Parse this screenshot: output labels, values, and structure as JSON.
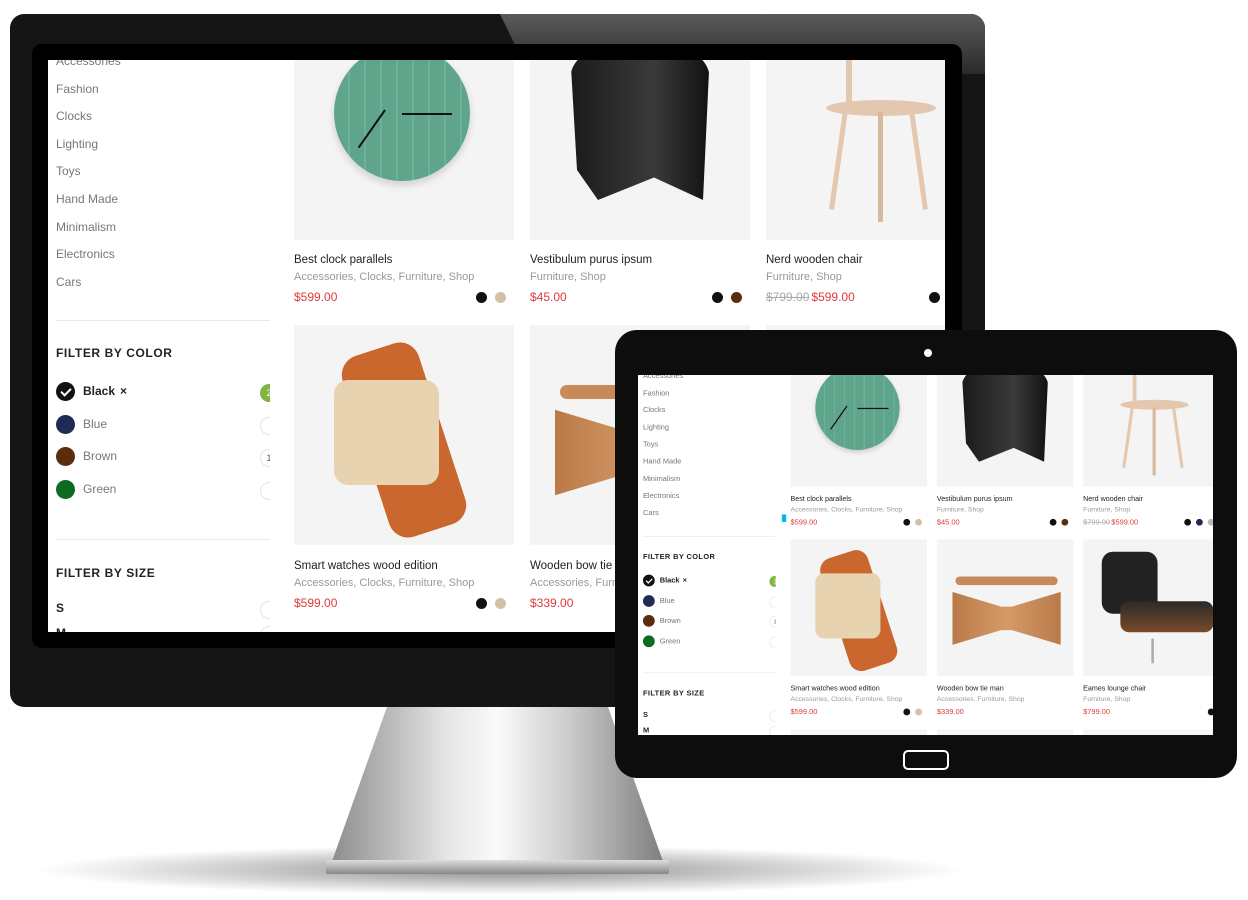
{
  "sidebar": {
    "categories": [
      "Accessories",
      "Fashion",
      "Clocks",
      "Lighting",
      "Toys",
      "Hand Made",
      "Minimalism",
      "Electronics",
      "Cars"
    ],
    "filter_color_title": "FILTER BY COLOR",
    "colors": [
      {
        "label": "Black",
        "remove": "×",
        "count": "2",
        "swatch": "#111111",
        "active": true
      },
      {
        "label": "Blue",
        "count": "",
        "swatch": "#1f2a55",
        "active": false
      },
      {
        "label": "Brown",
        "count": "1",
        "swatch": "#5a2d0c",
        "active": false
      },
      {
        "label": "Green",
        "count": "",
        "swatch": "#0c6b22",
        "active": false
      }
    ],
    "filter_size_title": "FILTER BY SIZE",
    "sizes": [
      {
        "label": "S"
      },
      {
        "label": "M"
      }
    ]
  },
  "products": [
    {
      "title": "Best clock parallels",
      "categories": "Accessories, Clocks, Furniture, Shop",
      "price": "$599.00",
      "old_price": "",
      "swatches": [
        "#111111",
        "#d3bfa3"
      ],
      "image": "clock"
    },
    {
      "title": "Vestibulum purus ipsum",
      "categories": "Furniture, Shop",
      "price": "$45.00",
      "old_price": "",
      "swatches": [
        "#111111",
        "#5a2d0c"
      ],
      "image": "stool"
    },
    {
      "title": "Nerd wooden chair",
      "categories": "Furniture, Shop",
      "price": "$599.00",
      "old_price": "$799.00",
      "swatches": [
        "#111111",
        "#1f2a55",
        "#bbbbbb"
      ],
      "image": "chair"
    },
    {
      "title": "Smart watches wood edition",
      "categories": "Accessories, Clocks, Furniture, Shop",
      "price": "$599.00",
      "old_price": "",
      "swatches": [
        "#111111",
        "#d3bfa3"
      ],
      "image": "watch"
    },
    {
      "title": "Wooden bow tie man",
      "categories": "Accessories, Furniture, Shop",
      "price": "$339.00",
      "old_price": "",
      "swatches": [],
      "image": "bowtie"
    },
    {
      "title": "Eames lounge chair",
      "categories": "Furniture, Shop",
      "price": "$799.00",
      "old_price": "",
      "swatches": [
        "#111111"
      ],
      "image": "lounge"
    }
  ],
  "colors": {
    "price": "#e03a3a",
    "badge_active": "#81b441",
    "bezel": "#151515"
  }
}
